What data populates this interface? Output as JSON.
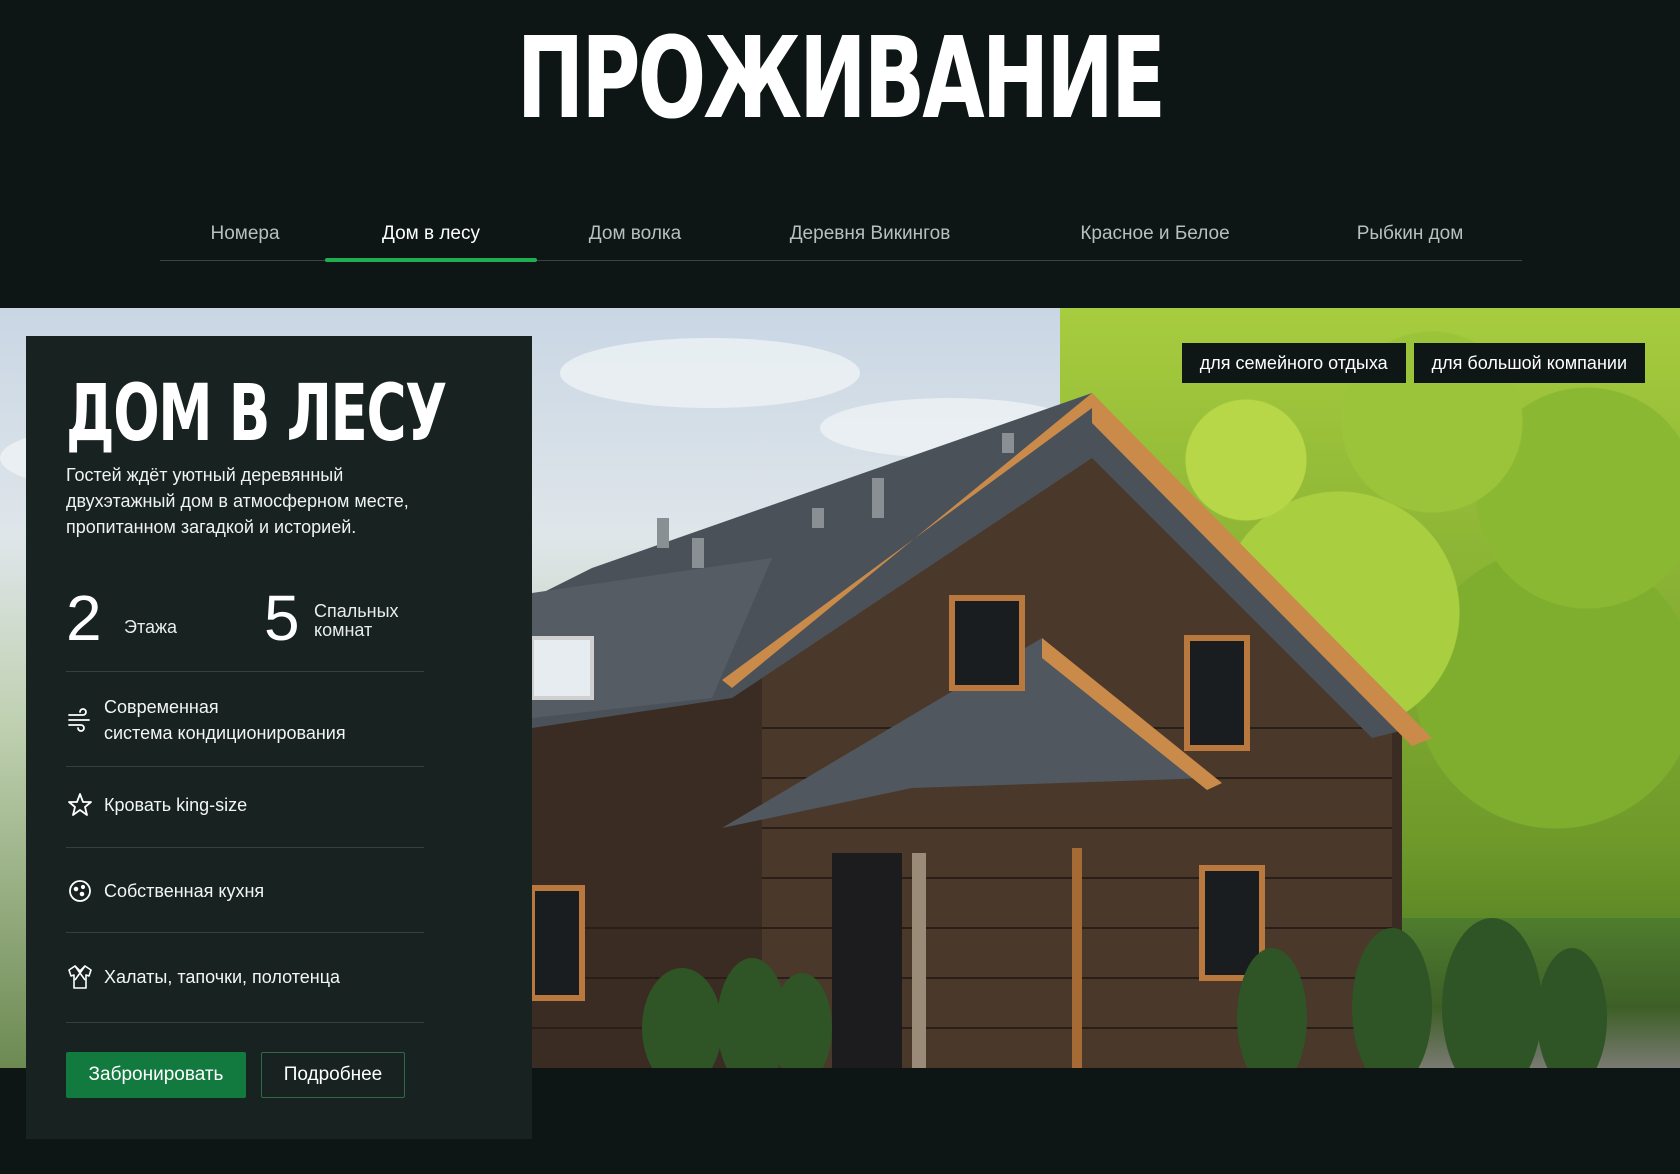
{
  "header": {
    "title": "ПРОЖИВАНИЕ"
  },
  "tabs": [
    {
      "label": "Номера",
      "active": false
    },
    {
      "label": "Дом в лесу",
      "active": true
    },
    {
      "label": "Дом волка",
      "active": false
    },
    {
      "label": "Деревня Викингов",
      "active": false
    },
    {
      "label": "Красное и Белое",
      "active": false
    },
    {
      "label": "Рыбкин дом",
      "active": false
    }
  ],
  "hero": {
    "tags": [
      "для семейного отдыха",
      "для большой компании"
    ]
  },
  "card": {
    "title": "ДОМ В ЛЕСУ",
    "description": "Гостей ждёт уютный деревянный двухэтажный дом в атмосферном месте, пропитанном загадкой и историей.",
    "stats": [
      {
        "value": "2",
        "label_line1": "Этажа",
        "label_line2": ""
      },
      {
        "value": "5",
        "label_line1": "Спальных",
        "label_line2": "комнат"
      }
    ],
    "features": [
      {
        "icon": "air-conditioning-icon",
        "line1": "Современная",
        "line2": "система кондиционирования"
      },
      {
        "icon": "star-icon",
        "line1": "Кровать king-size",
        "line2": ""
      },
      {
        "icon": "kitchen-icon",
        "line1": "Собственная кухня",
        "line2": ""
      },
      {
        "icon": "bathrobe-icon",
        "line1": "Халаты, тапочки, полотенца",
        "line2": ""
      }
    ],
    "buttons": {
      "book": "Забронировать",
      "more": "Подробнее"
    }
  },
  "colors": {
    "background": "#0e1515",
    "card": "#172221",
    "accent": "#1fae52",
    "button": "#137a3f"
  }
}
